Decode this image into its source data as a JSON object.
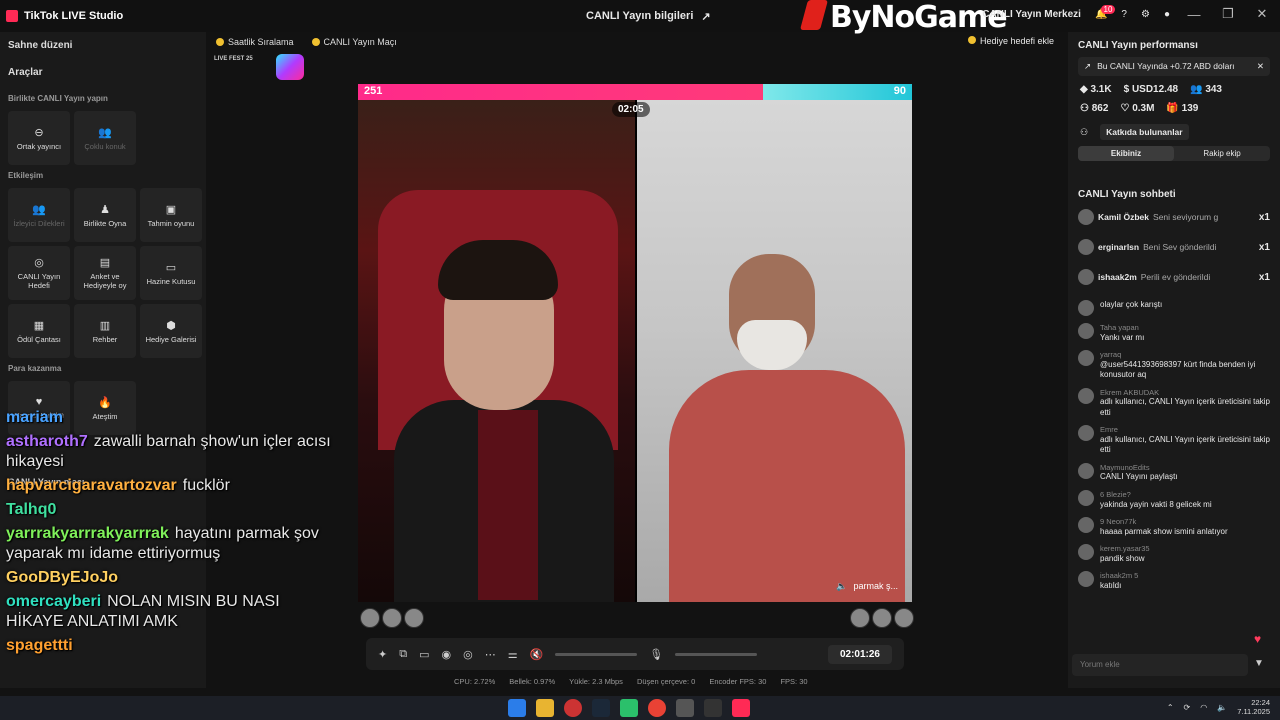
{
  "titlebar": {
    "app_name": "TikTok LIVE Studio",
    "center_title": "CANLI Yayın bilgileri",
    "watermark": "ByNoGame",
    "live_center": "CANLI Yayın Merkezi",
    "notif_count": "10",
    "minimize": "—",
    "maximize": "❐",
    "close": "✕"
  },
  "left_panel": {
    "scene_title": "Sahne düzeni",
    "tools_title": "Araçlar",
    "section_together": "Birlikte CANLI Yayın yapın",
    "together_tools": [
      "Ortak yayıncı",
      "Çoklu konuk"
    ],
    "section_engagement": "Etkileşim",
    "engagement_tools": [
      "İzleyici Dilekleri",
      "Birlikte Oyna",
      "Tahmin oyunu",
      "CANLI Yayın Hedefi",
      "Anket ve Hediyeyle oy",
      "Hazine Kutusu",
      "Ödül Çantası",
      "Rehber",
      "Hediye Galerisi"
    ],
    "section_money": "Para kazanma",
    "money_tools": [
      "Hayran Kulübü",
      "Ateştim"
    ],
    "match_label": "CANLI Yayın maçı"
  },
  "top_chips": {
    "hourly_rank": "Saatlik Sıralama",
    "live_match": "CANLI Yayın Maçı",
    "gift_goal": "Hediye hedefi ekle",
    "fest_label": "LIVE FEST 25"
  },
  "battle": {
    "score_left": "251",
    "score_right": "90",
    "timer": "02:05",
    "right_streamer": "parmak ş..."
  },
  "controls": {
    "elapsed": "02:01:26"
  },
  "stats": {
    "cpu": "CPU: 2.72%",
    "memory": "Bellek: 0.97%",
    "upload": "Yükle: 2.3 Mbps",
    "dropped": "Düşen çerçeve: 0",
    "encoder": "Encoder FPS: 30",
    "fps": "FPS: 30"
  },
  "right_panel": {
    "perf_title": "CANLI Yayın performansı",
    "earn_text": "Bu CANLI Yayında +0.72 ABD doları",
    "metrics": [
      "3.1K",
      "USD12.48",
      "343",
      "862",
      "0.3M",
      "139"
    ],
    "contributors": "Katkıda bulunanlar",
    "team_mine": "Ekibiniz",
    "team_rival": "Rakip ekip",
    "chat_title": "CANLI Yayın sohbeti",
    "gifts": [
      {
        "user": "Kamil Özbek",
        "msg": "Seni seviyorum g",
        "count": "x1"
      },
      {
        "user": "erginarlsn",
        "msg": "Beni Sev gönderildi",
        "count": "x1"
      },
      {
        "user": "ishaak2m",
        "msg": "Perili ev gönderildi",
        "count": "x1"
      }
    ],
    "messages": [
      {
        "meta": "",
        "text": "olaylar çok karıştı"
      },
      {
        "meta": "Taha yapan",
        "text": "Yankı var mı"
      },
      {
        "meta": "yarraq",
        "text": "@user5441393698397 kürt finda benden iyi konusutor aq"
      },
      {
        "meta": "Ekrem AKBUDAK",
        "text": "adlı kullanıcı, CANLI Yayın içerik üreticisini takip etti"
      },
      {
        "meta": "Emre",
        "text": "adlı kullanıcı, CANLI Yayın içerik üreticisini takip etti"
      },
      {
        "meta": "MaymunoEdits",
        "text": "CANLI Yayını paylaştı"
      },
      {
        "meta": "6 Blezie?",
        "text": "yakinda yayin vakti 8 gelicek mi"
      },
      {
        "meta": "9 Neon77k",
        "text": "haaaa parmak show ismini anlatıyor"
      },
      {
        "meta": "kerem.yasar35",
        "text": "pandik show"
      },
      {
        "meta": "ishaak2m 5",
        "text": "katıldı"
      }
    ],
    "comment_placeholder": "Yorum ekle"
  },
  "overlay_chat": [
    {
      "name": "mariam",
      "text": "",
      "color": "#4aa3ff"
    },
    {
      "name": "astharoth7",
      "text": "zawalli barnah şhow'un içler acısı hikayesi",
      "color": "#b070ff"
    },
    {
      "name": "hapvarcigaravartozvar",
      "text": "fucklör",
      "color": "#ffb040"
    },
    {
      "name": "Talhq0",
      "text": "",
      "color": "#40e0a0"
    },
    {
      "name": "yarrrakyarrrakyarrrak",
      "text": "hayatını parmak şov yaparak mı idame ettiriyormuş",
      "color": "#7ff05a"
    },
    {
      "name": "GooDByEJoJo",
      "text": "",
      "color": "#ffd060"
    },
    {
      "name": "omercayberi",
      "text": "NOLAN MISIN BU NASI HİKAYE ANLATIMI AMK",
      "color": "#30e0c0"
    },
    {
      "name": "spagettti",
      "text": "",
      "color": "#ffa030"
    }
  ],
  "taskbar": {
    "time": "22:24",
    "date": "7.11.2025"
  }
}
